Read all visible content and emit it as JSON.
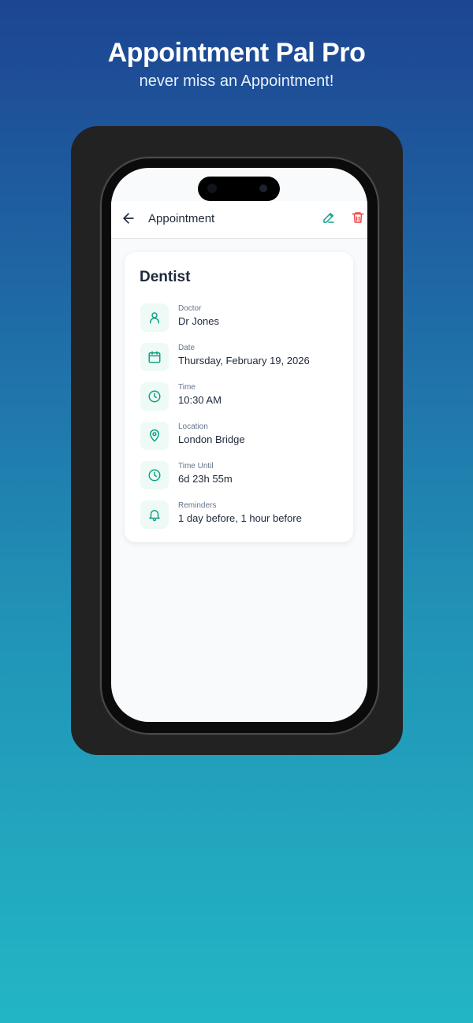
{
  "promo": {
    "title": "Appointment Pal Pro",
    "subtitle": "never miss an Appointment!"
  },
  "app_bar": {
    "title": "Appointment",
    "back_icon": "arrow-left-icon",
    "edit_icon": "pencil-icon",
    "delete_icon": "trash-icon"
  },
  "appointment": {
    "title": "Dentist",
    "details": [
      {
        "label": "Doctor",
        "value": "Dr Jones",
        "icon": "user-icon"
      },
      {
        "label": "Date",
        "value": "Thursday, February 19, 2026",
        "icon": "calendar-icon"
      },
      {
        "label": "Time",
        "value": "10:30 AM",
        "icon": "clock-icon"
      },
      {
        "label": "Location",
        "value": "London Bridge",
        "icon": "map-pin-icon"
      },
      {
        "label": "Time Until",
        "value": "6d 23h 55m",
        "icon": "clock-icon"
      },
      {
        "label": "Reminders",
        "value": "1 day before, 1 hour before",
        "icon": "bell-icon"
      }
    ]
  },
  "colors": {
    "accent": "#14a085",
    "danger": "#ef4444",
    "text": "#1e293b",
    "muted": "#64748b"
  }
}
